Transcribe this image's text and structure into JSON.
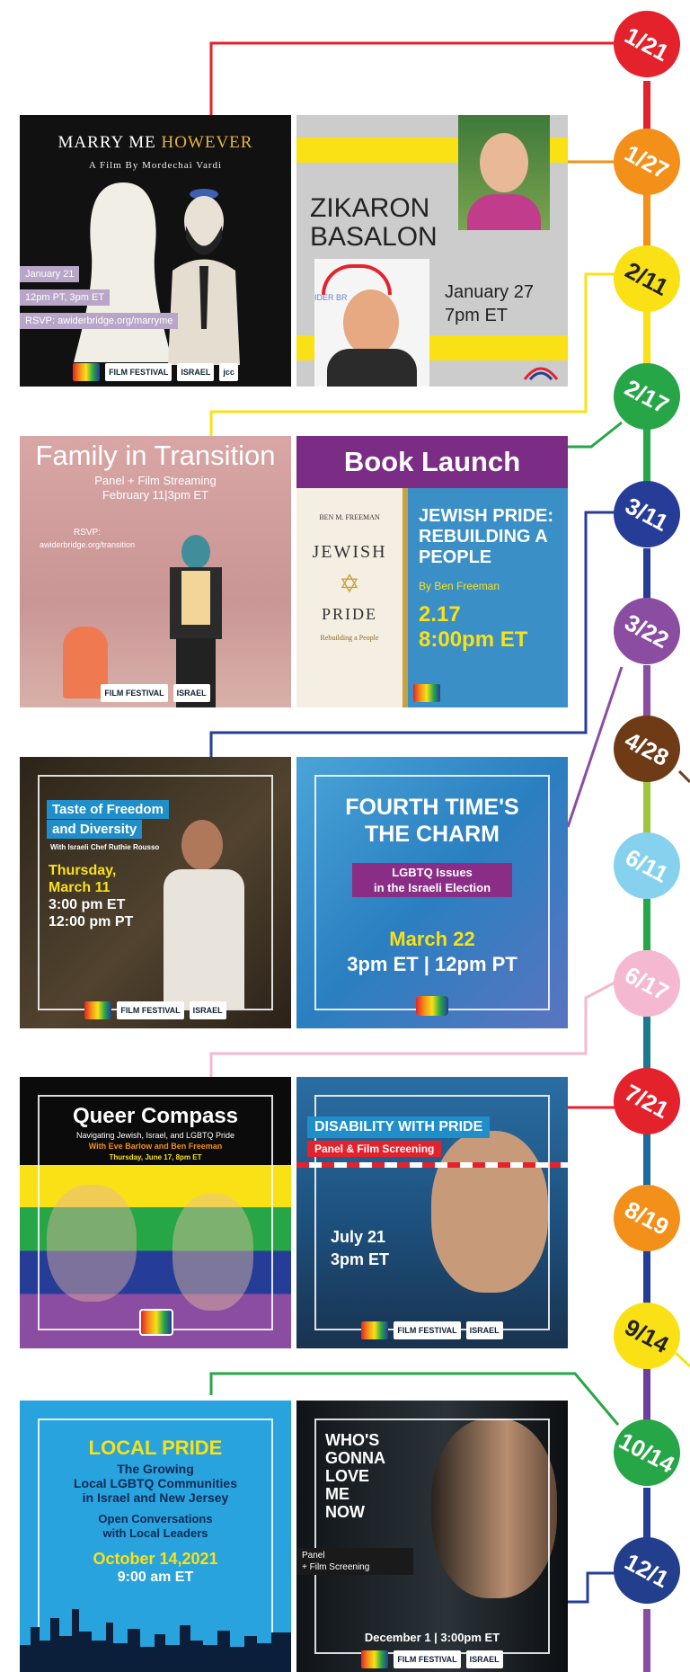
{
  "colors": {
    "red": "#e4222c",
    "orange": "#f39019",
    "yellow": "#f9e116",
    "green": "#27a647",
    "navy": "#263d97",
    "purple": "#8a4da1",
    "brown": "#6e3b16",
    "lightblue": "#86d2ee",
    "pink": "#f4b8d1",
    "lime": "#9ec63b",
    "darkblue": "#233e8c"
  },
  "timeline": {
    "badges": [
      "1/21",
      "1/27",
      "2/11",
      "2/17",
      "3/11",
      "3/22",
      "4/28",
      "6/11",
      "6/17",
      "7/21",
      "8/19",
      "9/14",
      "10/14",
      "12/1"
    ]
  },
  "events": {
    "marry": {
      "title_white": "MARRY ME ",
      "title_gold": "HOWEVER",
      "subtitle": "A Film By Mordechai Vardi",
      "date": "January 21",
      "time": "12pm PT, 3pm ET",
      "rsvp": "RSVP: awiderbridge.org/marryme",
      "logos": [
        "FILM FESTIVAL",
        "ISRAEL",
        "jcc"
      ]
    },
    "zikaron": {
      "title_line1": "ZIKARON",
      "title_line2": "BASALON",
      "date": "January 27",
      "time": "7pm ET",
      "logo_caption": "IDER BR"
    },
    "family": {
      "title": "Family in Transition",
      "sub1": "Panel + Film Streaming",
      "sub2": "February 11|3pm ET",
      "rsvp1": "RSVP:",
      "rsvp2": "awiderbridge.org/transition",
      "logos": [
        "FILM FESTIVAL",
        "ISRAEL"
      ]
    },
    "book": {
      "header": "Book Launch",
      "author_cover": "BEN M. FREEMAN",
      "cover_word1": "JEWISH",
      "cover_word2": "PRIDE",
      "cover_sub": "Rebuilding a People",
      "headline": "JEWISH PRIDE: REBUILDING A PEOPLE",
      "byline": "By Ben Freeman",
      "date": "2.17",
      "time": "8:00pm ET"
    },
    "taste": {
      "title1": "Taste of Freedom",
      "title2": "and Diversity",
      "subtitle": "With Israeli Chef Ruthie Rousso",
      "day": "Thursday,",
      "date": "March 11",
      "time1": "3:00 pm ET",
      "time2": "12:00 pm PT",
      "logos": [
        "FILM FESTIVAL",
        "ISRAEL"
      ]
    },
    "fourth": {
      "title1": "FOURTH TIME'S",
      "title2": "THE CHARM",
      "band1": "LGBTQ Issues",
      "band2": "in the Israeli Election",
      "date": "March 22",
      "time": "3pm ET | 12pm PT"
    },
    "queer": {
      "title": "Queer Compass",
      "sub1": "Navigating Jewish, Israel, and LGBTQ Pride",
      "sub2": "With Eve Barlow and Ben Freeman",
      "sub3": "Thursday, June 17, 8pm ET"
    },
    "disability": {
      "title": "DISABILITY WITH PRIDE",
      "sub": "Panel & Film Screening",
      "date": "July 21",
      "time": "3pm ET",
      "logos": [
        "FILM FESTIVAL",
        "ISRAEL"
      ]
    },
    "local": {
      "title": "LOCAL PRIDE",
      "line1": "The Growing",
      "line2": "Local LGBTQ Communities",
      "line3": "in Israel and New Jersey",
      "line4": "Open Conversations",
      "line5": "with Local Leaders",
      "date": "October 14,2021",
      "time": "9:00 am ET"
    },
    "whos": {
      "title1": "WHO'S",
      "title2": "GONNA",
      "title3": "LOVE",
      "title4": "ME",
      "title5": "NOW",
      "sub1": "Panel",
      "sub2": "+ Film Screening",
      "date": "December 1 | 3:00pm ET",
      "logos": [
        "FILM FESTIVAL",
        "ISRAEL"
      ]
    }
  }
}
